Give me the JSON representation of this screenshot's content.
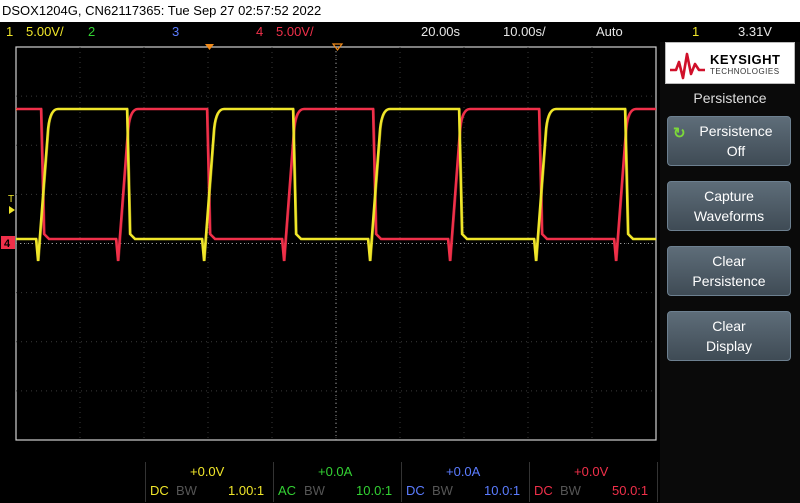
{
  "title_bar": {
    "text": "DSOX1204G, CN62117365: Tue Sep 27 02:57:52 2022"
  },
  "top_status": {
    "ch1_num": "1",
    "ch1_scale": "5.00V/",
    "ch2_num": "2",
    "ch3_num": "3",
    "ch4_num": "4",
    "ch4_scale": "5.00V/",
    "time_delay": "20.00s",
    "time_scale": "10.00s/",
    "trigger_mode": "Auto",
    "trigger_source": "1",
    "trigger_level": "3.31V"
  },
  "right_panel": {
    "logo_brand": "KEYSIGHT",
    "logo_sub": "TECHNOLOGIES",
    "menu_title": "Persistence",
    "softkeys": [
      {
        "line1": "Persistence",
        "line2": "Off"
      },
      {
        "line1": "Capture",
        "line2": "Waveforms"
      },
      {
        "line1": "Clear",
        "line2": "Persistence"
      },
      {
        "line1": "Clear",
        "line2": "Display"
      }
    ]
  },
  "markers": {
    "trigger_label": "T",
    "ch4_marker": "4"
  },
  "bottom_channels": [
    {
      "offset": "+0.0V",
      "coupling": "DC",
      "bw": "BW",
      "probe": "1.00:1"
    },
    {
      "offset": "+0.0A",
      "coupling": "AC",
      "bw": "BW",
      "probe": "10.0:1"
    },
    {
      "offset": "+0.0A",
      "coupling": "DC",
      "bw": "BW",
      "probe": "10.0:1"
    },
    {
      "offset": "+0.0V",
      "coupling": "DC",
      "bw": "BW",
      "probe": "50.0:1"
    }
  ],
  "colors": {
    "ch1": "#f0e62a",
    "ch2": "#33d133",
    "ch3": "#5b7cff",
    "ch4": "#f0304a",
    "softkey_accent": "#7cd83a"
  },
  "icons": {
    "persistence_toggle": "circular-arrow-icon",
    "keysight_logo": "waveform-logo-icon"
  }
}
